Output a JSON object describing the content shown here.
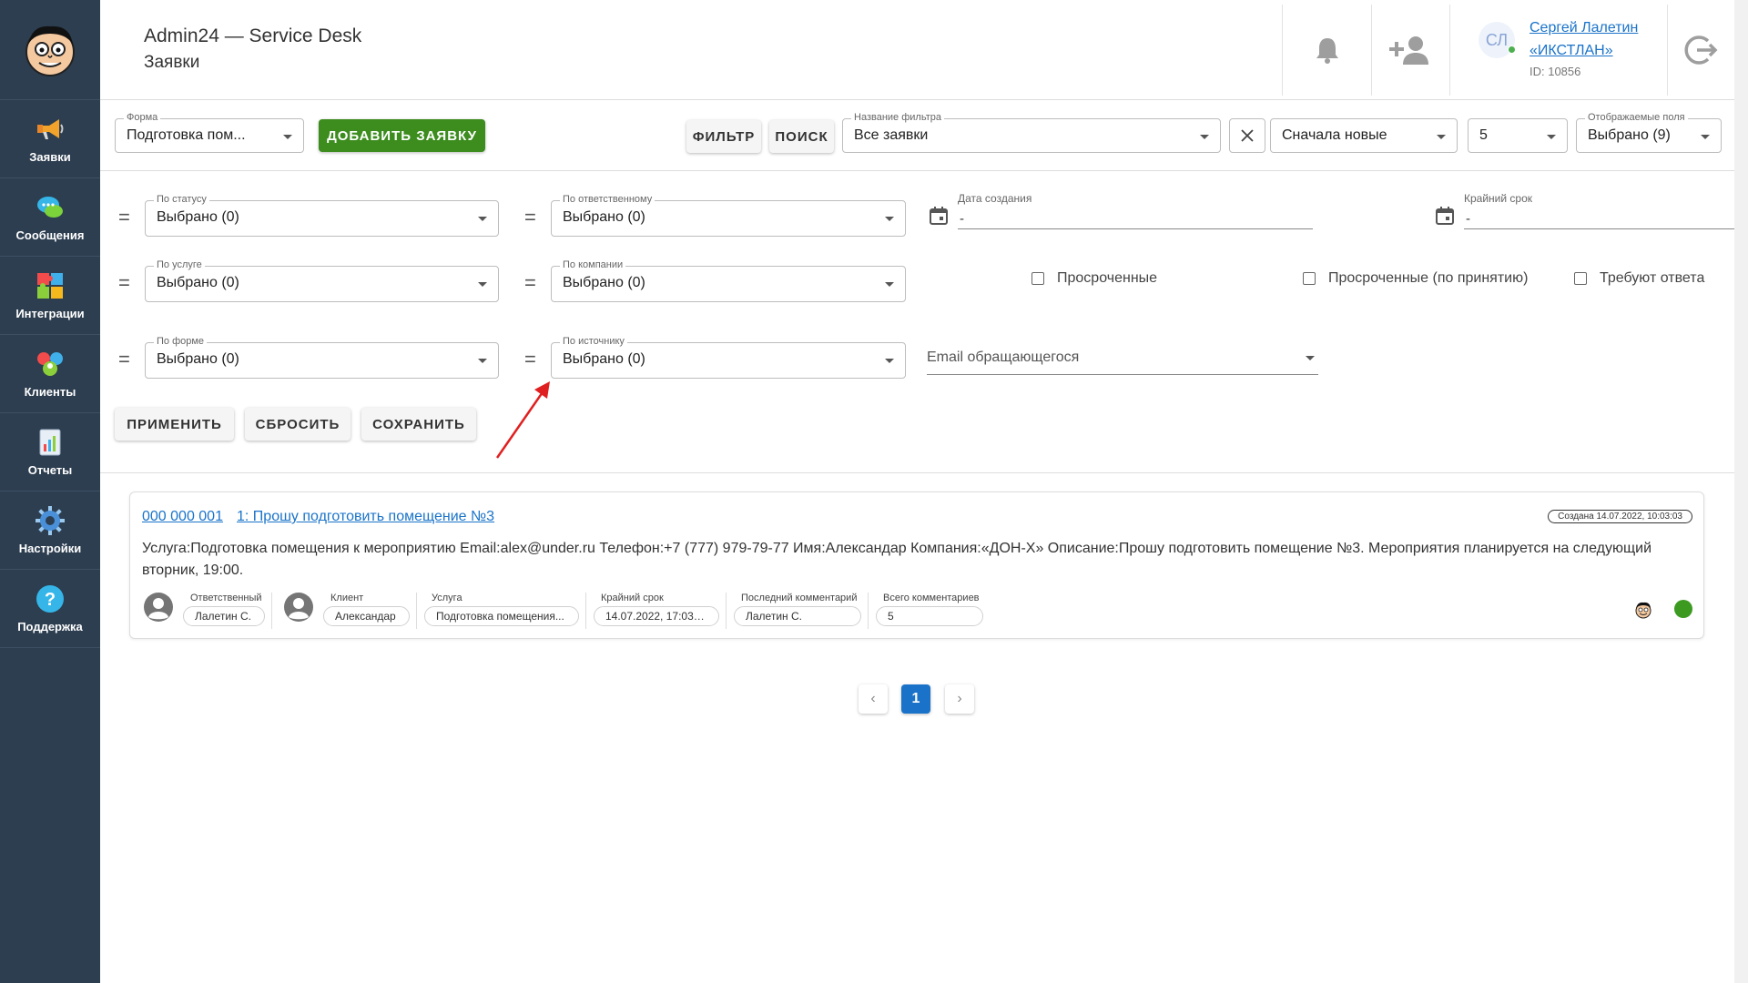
{
  "header": {
    "title": "Admin24 — Service Desk",
    "subtitle": "Заявки",
    "user": {
      "initials": "СЛ",
      "name": "Сергей Лалетин",
      "org": "«ИКСТЛАН»",
      "id": "ID: 10856"
    }
  },
  "sidebar": {
    "items": [
      {
        "label": "Заявки",
        "icon": "megaphone-icon"
      },
      {
        "label": "Сообщения",
        "icon": "chat-bubbles-icon"
      },
      {
        "label": "Интеграции",
        "icon": "puzzle-icon"
      },
      {
        "label": "Клиенты",
        "icon": "clients-icon"
      },
      {
        "label": "Отчеты",
        "icon": "report-chart-icon"
      },
      {
        "label": "Настройки",
        "icon": "gear-icon"
      },
      {
        "label": "Поддержка",
        "icon": "help-icon"
      }
    ]
  },
  "toolbar": {
    "form": {
      "label": "Форма",
      "value": "Подготовка пом..."
    },
    "add_button": "ДОБАВИТЬ ЗАЯВКУ",
    "filter_button": "ФИЛЬТР",
    "search_button": "ПОИСК",
    "filter_name": {
      "label": "Название фильтра",
      "value": "Все заявки"
    },
    "sort": {
      "value": "Сначала новые"
    },
    "page_size": {
      "value": "5"
    },
    "fields": {
      "label": "Отображаемые поля",
      "value": "Выбрано (9)"
    }
  },
  "filters": {
    "status": {
      "label": "По статусу",
      "value": "Выбрано (0)"
    },
    "responsible": {
      "label": "По ответственному",
      "value": "Выбрано (0)"
    },
    "service": {
      "label": "По услуге",
      "value": "Выбрано (0)"
    },
    "company": {
      "label": "По компании",
      "value": "Выбрано (0)"
    },
    "form": {
      "label": "По форме",
      "value": "Выбрано (0)"
    },
    "source": {
      "label": "По источнику",
      "value": "Выбрано (0)"
    },
    "created_date": {
      "label": "Дата создания",
      "value": "-"
    },
    "deadline": {
      "label": "Крайний срок",
      "value": "-"
    },
    "overdue": "Просроченные",
    "overdue_accept": "Просроченные (по принятию)",
    "need_reply": "Требуют ответа",
    "email_placeholder": "Email обращающегося",
    "eq_symbol": "=",
    "apply": "ПРИМЕНИТЬ",
    "reset": "СБРОСИТЬ",
    "save": "СОХРАНИТЬ"
  },
  "ticket": {
    "number": "000 000 001",
    "title": "1: Прошу подготовить помещение №3",
    "created": "Создана 14.07.2022, 10:03:03",
    "description": "Услуга:Подготовка помещения к мероприятию Email:alex@under.ru Телефон:+7 (777) 979-79-77 Имя:Александар Компания:«ДОН-Х» Описание:Прошу подготовить помещение №3. Мероприятия планируется на следующий вторник, 19:00.",
    "meta": [
      {
        "label": "Ответственный",
        "value": "Лалетин С."
      },
      {
        "label": "Клиент",
        "value": "Александар"
      },
      {
        "label": "Услуга",
        "value": "Подготовка помещения..."
      },
      {
        "label": "Крайний срок",
        "value": "14.07.2022, 17:03:00"
      },
      {
        "label": "Последний комментарий",
        "value": "Лалетин С."
      },
      {
        "label": "Всего комментариев",
        "value": "5"
      }
    ],
    "status_color": "#3b9a1f"
  },
  "pagination": {
    "current": "1",
    "prev": "‹",
    "next": "›"
  },
  "colors": {
    "sidebar": "#2d3e50",
    "accent": "#1a73c9",
    "add_button": "#3c8c1e",
    "arrow": "#e02020"
  }
}
